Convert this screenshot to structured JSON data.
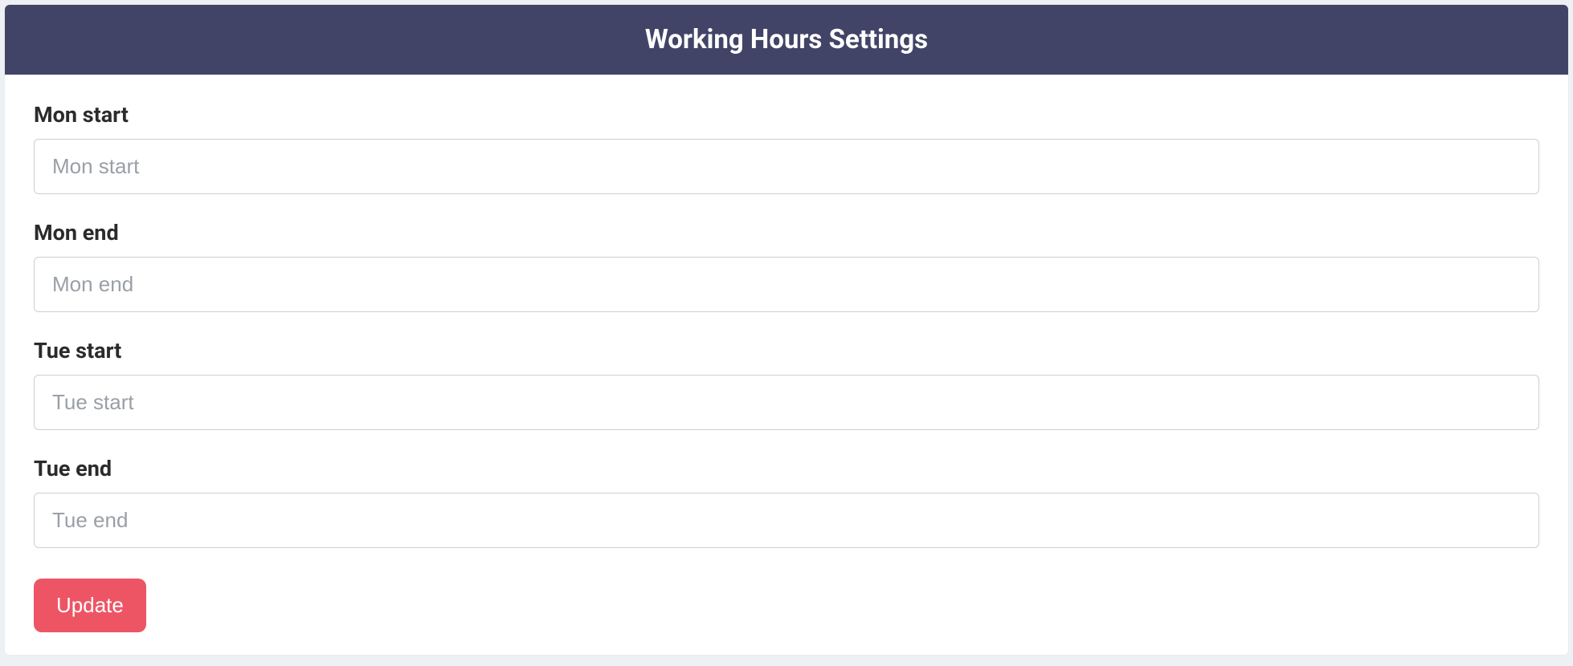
{
  "header": {
    "title": "Working Hours Settings"
  },
  "form": {
    "fields": [
      {
        "label": "Mon start",
        "placeholder": "Mon start",
        "value": ""
      },
      {
        "label": "Mon end",
        "placeholder": "Mon end",
        "value": ""
      },
      {
        "label": "Tue start",
        "placeholder": "Tue start",
        "value": ""
      },
      {
        "label": "Tue end",
        "placeholder": "Tue end",
        "value": ""
      }
    ],
    "submit_label": "Update"
  },
  "colors": {
    "header_bg": "#424467",
    "page_bg": "#eef1f4",
    "button_bg": "#ed5565"
  }
}
